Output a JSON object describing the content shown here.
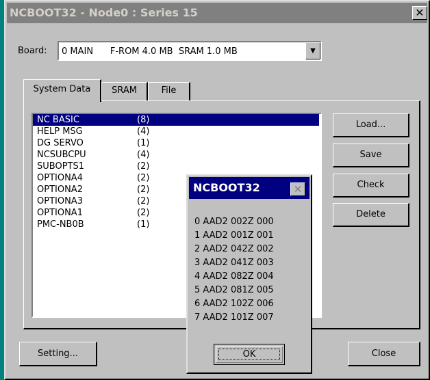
{
  "window": {
    "title": "NCBOOT32 - Node0 : Series 15",
    "close_glyph": "✕"
  },
  "board": {
    "label": "Board:",
    "value": "0 MAIN      F-ROM 4.0 MB  SRAM 1.0 MB"
  },
  "tabs": [
    {
      "label": "System Data",
      "active": true
    },
    {
      "label": "SRAM",
      "active": false
    },
    {
      "label": "File",
      "active": false
    }
  ],
  "list": [
    {
      "name": "NC BASIC",
      "count": "(8)",
      "selected": true
    },
    {
      "name": "HELP MSG",
      "count": "(4)"
    },
    {
      "name": "DG SERVO",
      "count": "(1)"
    },
    {
      "name": "NCSUBCPU",
      "count": "(4)"
    },
    {
      "name": "SUBOPTS1",
      "count": "(2)"
    },
    {
      "name": "OPTIONA4",
      "count": "(2)"
    },
    {
      "name": "OPTIONA2",
      "count": "(2)"
    },
    {
      "name": "OPTIONA3",
      "count": "(2)"
    },
    {
      "name": "OPTIONA1",
      "count": "(2)"
    },
    {
      "name": "PMC-NB0B",
      "count": "(1)"
    }
  ],
  "buttons": {
    "load": "Load...",
    "save": "Save",
    "check": "Check",
    "delete": "Delete",
    "setting": "Setting...",
    "close": "Close"
  },
  "dialog": {
    "title": "NCBOOT32",
    "close_glyph": "✕",
    "lines": [
      "0 AAD2 002Z 000",
      "1 AAD2 001Z 001",
      "2 AAD2 042Z 002",
      "3 AAD2 041Z 003",
      "4 AAD2 082Z 004",
      "5 AAD2 081Z 005",
      "6 AAD2 102Z 006",
      "7 AAD2 101Z 007"
    ],
    "ok": "OK"
  }
}
